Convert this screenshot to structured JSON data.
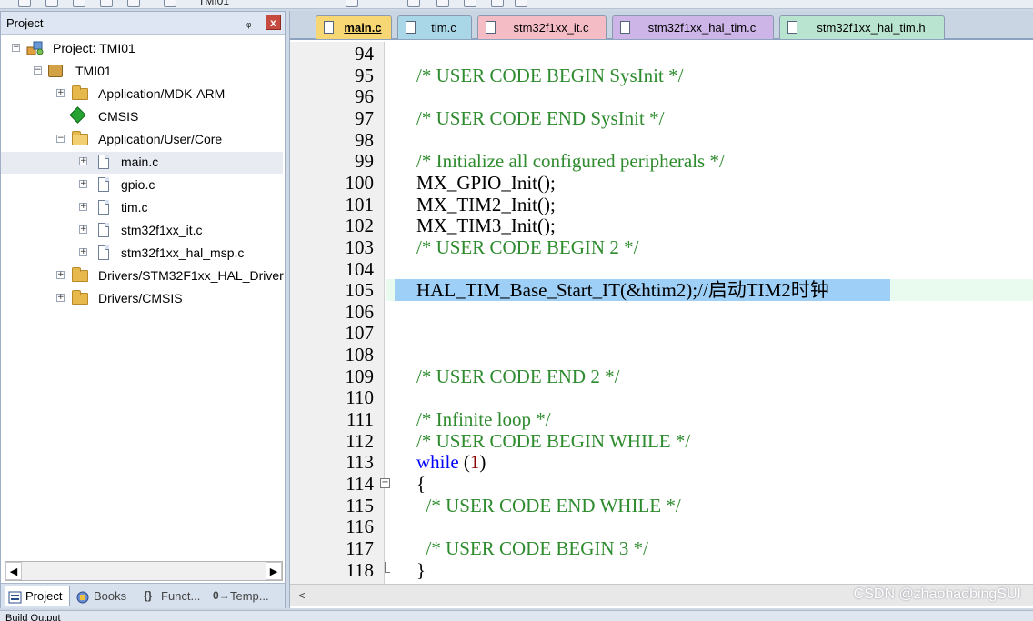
{
  "toolbar": {
    "title_fragment": "TMI01"
  },
  "project_panel": {
    "title": "Project",
    "pin_glyph": "ᵩ",
    "close_glyph": "x",
    "tree": [
      {
        "label": "Project: TMI01",
        "icon": "project-icon",
        "expander": "−"
      },
      {
        "label": "TMI01",
        "icon": "target-icon",
        "expander": "−"
      },
      {
        "label": "Application/MDK-ARM",
        "icon": "folder-icon",
        "expander": "+"
      },
      {
        "label": "CMSIS",
        "icon": "diamond-icon",
        "expander": ""
      },
      {
        "label": "Application/User/Core",
        "icon": "folder-open-icon",
        "expander": "−"
      },
      {
        "label": "main.c",
        "icon": "file-icon",
        "expander": "+"
      },
      {
        "label": "gpio.c",
        "icon": "file-icon",
        "expander": "+"
      },
      {
        "label": "tim.c",
        "icon": "file-icon",
        "expander": "+"
      },
      {
        "label": "stm32f1xx_it.c",
        "icon": "file-icon",
        "expander": "+"
      },
      {
        "label": "stm32f1xx_hal_msp.c",
        "icon": "file-icon",
        "expander": "+"
      },
      {
        "label": "Drivers/STM32F1xx_HAL_Driver",
        "icon": "folder-icon",
        "expander": "+"
      },
      {
        "label": "Drivers/CMSIS",
        "icon": "folder-icon",
        "expander": "+"
      }
    ],
    "tabs": [
      {
        "label": "Project",
        "icon": "project-tab-icon"
      },
      {
        "label": "Books",
        "icon": "books-icon"
      },
      {
        "label": "Funct...",
        "icon": "functions-icon",
        "glyph": "{}"
      },
      {
        "label": "Temp...",
        "icon": "templates-icon",
        "glyph": "0→"
      }
    ]
  },
  "editor": {
    "tabs": [
      {
        "label": "main.c",
        "color": "#f7d774"
      },
      {
        "label": "tim.c",
        "color": "#a9d7e8"
      },
      {
        "label": "stm32f1xx_it.c",
        "color": "#f4bcc4"
      },
      {
        "label": "stm32f1xx_hal_tim.c",
        "color": "#cdb5e8"
      },
      {
        "label": "stm32f1xx_hal_tim.h",
        "color": "#b9e4cf"
      }
    ],
    "lines": [
      {
        "n": "94",
        "parts": []
      },
      {
        "n": "95",
        "parts": [
          {
            "t": "/* USER CODE BEGIN SysInit */",
            "c": "comment"
          }
        ]
      },
      {
        "n": "96",
        "parts": []
      },
      {
        "n": "97",
        "parts": [
          {
            "t": "/* USER CODE END SysInit */",
            "c": "comment"
          }
        ]
      },
      {
        "n": "98",
        "parts": []
      },
      {
        "n": "99",
        "parts": [
          {
            "t": "/* Initialize all configured peripherals */",
            "c": "comment"
          }
        ]
      },
      {
        "n": "100",
        "parts": [
          {
            "t": "MX_GPIO_Init();",
            "c": "plain"
          }
        ]
      },
      {
        "n": "101",
        "parts": [
          {
            "t": "MX_TIM2_Init();",
            "c": "plain"
          }
        ]
      },
      {
        "n": "102",
        "parts": [
          {
            "t": "MX_TIM3_Init();",
            "c": "plain"
          }
        ]
      },
      {
        "n": "103",
        "parts": [
          {
            "t": "/* USER CODE BEGIN 2 */",
            "c": "comment"
          }
        ]
      },
      {
        "n": "104",
        "parts": []
      },
      {
        "n": "105",
        "parts": [
          {
            "t": "HAL_TIM_Base_Start_IT(&htim2);//启动TIM2时钟",
            "c": "plain"
          }
        ],
        "highlight": true
      },
      {
        "n": "106",
        "parts": []
      },
      {
        "n": "107",
        "parts": []
      },
      {
        "n": "108",
        "parts": []
      },
      {
        "n": "109",
        "parts": [
          {
            "t": "/* USER CODE END 2 */",
            "c": "comment"
          }
        ]
      },
      {
        "n": "110",
        "parts": []
      },
      {
        "n": "111",
        "parts": [
          {
            "t": "/* Infinite loop */",
            "c": "comment"
          }
        ]
      },
      {
        "n": "112",
        "parts": [
          {
            "t": "/* USER CODE BEGIN WHILE */",
            "c": "comment"
          }
        ]
      },
      {
        "n": "113",
        "parts": [
          {
            "t": "while",
            "c": "kw"
          },
          {
            "t": " (",
            "c": "plain"
          },
          {
            "t": "1",
            "c": "num"
          },
          {
            "t": ")",
            "c": "plain"
          }
        ]
      },
      {
        "n": "114",
        "parts": [
          {
            "t": "{",
            "c": "plain"
          }
        ],
        "fold": "start"
      },
      {
        "n": "115",
        "parts": [
          {
            "t": "  /* USER CODE END WHILE */",
            "c": "comment"
          }
        ]
      },
      {
        "n": "116",
        "parts": []
      },
      {
        "n": "117",
        "parts": [
          {
            "t": "  /* USER CODE BEGIN 3 */",
            "c": "comment"
          }
        ]
      },
      {
        "n": "118",
        "parts": [
          {
            "t": "}",
            "c": "plain"
          }
        ],
        "fold": "end"
      }
    ],
    "hscroll_arrow": "<",
    "watermark": "CSDN @zhaohaobingSUI"
  },
  "status": {
    "bottom_label": "Build Output"
  }
}
